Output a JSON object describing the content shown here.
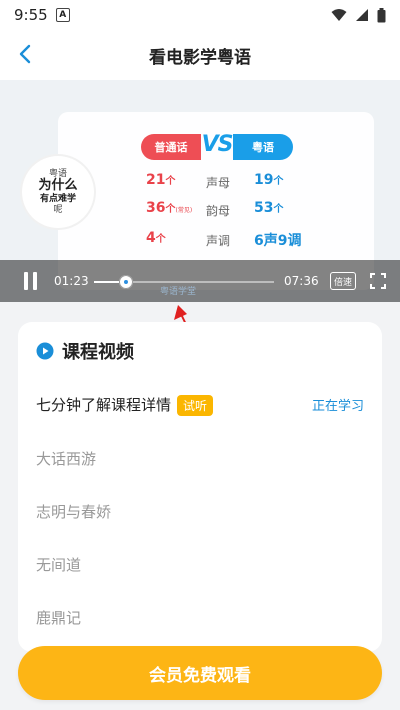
{
  "status_bar": {
    "time": "9:55",
    "notification_letter": "A"
  },
  "nav": {
    "title": "看电影学粤语"
  },
  "player": {
    "bubble": [
      "粤语",
      "为什么",
      "有点难学",
      "呢"
    ],
    "compare_left_label": "普通话",
    "compare_vs": "VS",
    "compare_right_label": "粤语",
    "rows": [
      {
        "left_num": "21",
        "left_unit": "个",
        "left_note": "",
        "mid": "声母",
        "right_num": "19",
        "right_unit": "个"
      },
      {
        "left_num": "36",
        "left_unit": "个",
        "left_note": "(常见)",
        "mid": "韵母",
        "right_num": "53",
        "right_unit": "个"
      },
      {
        "left_num": "4",
        "left_unit": "个",
        "left_note": "",
        "mid": "声调",
        "right_num": "6声9调",
        "right_unit": ""
      }
    ],
    "current_time": "01:23",
    "total_time": "07:36",
    "progress": 0.18,
    "speed_label": "倍速",
    "watermark": "粤语学堂"
  },
  "course": {
    "section_title": "课程视频",
    "lessons": [
      {
        "title": "七分钟了解课程详情",
        "badge": "试听",
        "status": "正在学习"
      },
      {
        "title": "大话西游"
      },
      {
        "title": "志明与春娇"
      },
      {
        "title": "无间道"
      },
      {
        "title": "鹿鼎记"
      }
    ]
  },
  "cta": {
    "label": "会员免费观看"
  },
  "colors": {
    "accent_blue": "#1a8ed8",
    "accent_red": "#e9424a",
    "cta_yellow": "#fdb515",
    "arrow_red": "#e02020"
  }
}
